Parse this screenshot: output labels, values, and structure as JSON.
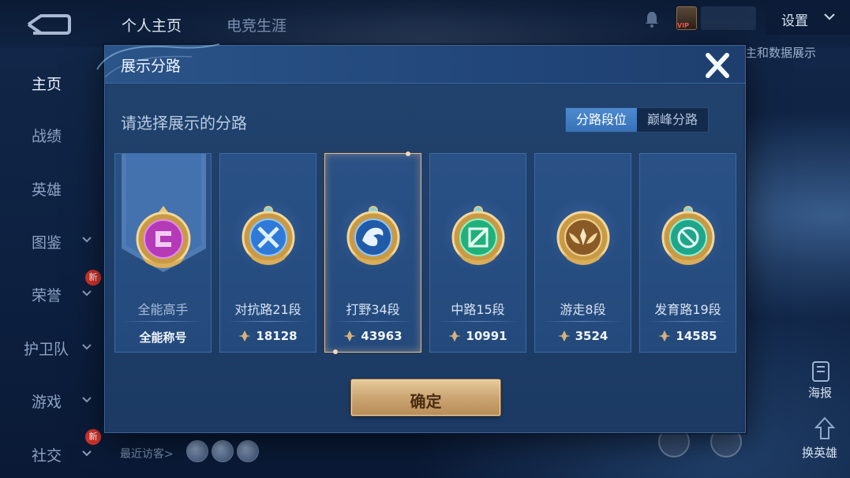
{
  "topbar": {
    "tabs": [
      "个人主页",
      "电竞生涯"
    ],
    "settings_label": "设置",
    "right_note": "主和数据展示",
    "vip_label": "VIP"
  },
  "sidebar": {
    "items": [
      {
        "label": "主页",
        "active": true
      },
      {
        "label": "战绩"
      },
      {
        "label": "英雄"
      },
      {
        "label": "图鉴"
      },
      {
        "label": "荣誉"
      },
      {
        "label": "护卫队"
      },
      {
        "label": "游戏"
      },
      {
        "label": "社交"
      }
    ],
    "new_badge": "新"
  },
  "bottom": {
    "visitor_label": "最近访客>",
    "poster_label": "海报",
    "swap_label": "换英雄"
  },
  "modal": {
    "title": "展示分路",
    "prompt": "请选择展示的分路",
    "segments": [
      "分路段位",
      "巅峰分路"
    ],
    "active_segment": 0,
    "cards": [
      {
        "name": "全能高手",
        "score": "全能称号",
        "badge": "purple",
        "selected": false
      },
      {
        "name": "对抗路21段",
        "score": "18128",
        "badge": "blue-sword",
        "selected": false
      },
      {
        "name": "打野34段",
        "score": "43963",
        "badge": "dragon",
        "selected": true
      },
      {
        "name": "中路15段",
        "score": "10991",
        "badge": "green",
        "selected": false
      },
      {
        "name": "游走8段",
        "score": "3524",
        "badge": "gold-wing",
        "selected": false
      },
      {
        "name": "发育路19段",
        "score": "14585",
        "badge": "teal",
        "selected": false
      }
    ],
    "confirm_label": "确定"
  },
  "colors": {
    "accent_gold": "#cba572",
    "selected_border": "#e7b98c",
    "segment_active": "#3772b8"
  }
}
